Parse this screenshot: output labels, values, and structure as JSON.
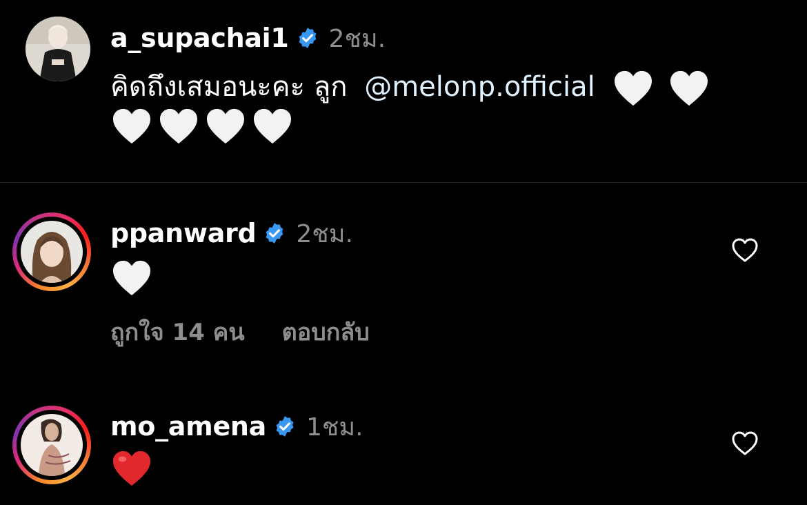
{
  "colors": {
    "background": "#000000",
    "text": "#ffffff",
    "muted": "#8e8e8e",
    "verified": "#3897f0",
    "mention": "#e0f1ff",
    "red_heart": "#e0282d",
    "white_heart": "#f2f2f2"
  },
  "comments": [
    {
      "username": "a_supachai1",
      "verified": true,
      "time": "2ชม.",
      "text": "คิดถึงเสมอนะคะ ลูก",
      "mention": "@melonp.official",
      "emoji": "white-heart",
      "emoji_count": 6
    },
    {
      "username": "ppanward",
      "verified": true,
      "time": "2ชม.",
      "emoji": "white-heart",
      "emoji_count": 1,
      "likes_label": "ถูกใจ 14 คน",
      "reply_label": "ตอบกลับ"
    },
    {
      "username": "mo_amena",
      "verified": true,
      "time": "1ชม.",
      "emoji": "red-heart",
      "emoji_count": 1
    }
  ]
}
